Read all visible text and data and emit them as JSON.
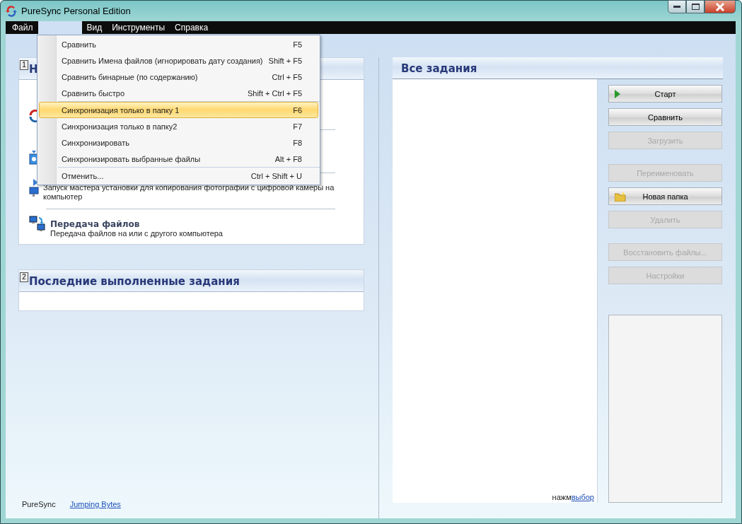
{
  "window": {
    "title": "PureSync Personal Edition"
  },
  "menu_bar": [
    {
      "label": "Файл",
      "selected": false
    },
    {
      "selected": true
    },
    {
      "label": "Вид",
      "selected": false
    },
    {
      "label": "Инструменты",
      "selected": false
    },
    {
      "label": "Справка",
      "selected": false
    }
  ],
  "dropdown": [
    {
      "kind": "item",
      "label": "Сравнить",
      "shortcut": "F5",
      "selected": false
    },
    {
      "kind": "item",
      "label": "Сравнить Имена файлов (игнорировать дату создания)",
      "shortcut": "Shift + F5",
      "selected": false
    },
    {
      "kind": "item",
      "label": "Сравнить бинарные (по содержанию)",
      "shortcut": "Ctrl + F5",
      "selected": false
    },
    {
      "kind": "item",
      "label": "Сравнить быстро",
      "shortcut": "Shift + Ctrl + F5",
      "selected": false
    },
    {
      "kind": "separator"
    },
    {
      "kind": "item",
      "label": "Синхронизация только в папку 1",
      "shortcut": "F6",
      "selected": true
    },
    {
      "kind": "item",
      "label": "Синхронизация только в папку2",
      "shortcut": "F7",
      "selected": false
    },
    {
      "kind": "item",
      "label": "Синхронизировать",
      "shortcut": "F8",
      "selected": false
    },
    {
      "kind": "item",
      "label": "Синхронизировать выбранные файлы",
      "shortcut": "Alt + F8",
      "selected": false
    },
    {
      "kind": "separator"
    },
    {
      "kind": "item",
      "label": "Отменить...",
      "shortcut": "Ctrl + Shift + U",
      "selected": false
    }
  ],
  "section_1": {
    "number": "1",
    "title": "Н",
    "tasks": [
      {
        "kind": "sync"
      },
      {
        "kind": "device"
      },
      {
        "kind": "camera",
        "description": "Запуск мастера установки для копирования фотографии с цифровой камеры на компьютер"
      },
      {
        "kind": "transfer",
        "title": "Передача файлов",
        "description": "Передача файлов на или с другого компьютера"
      }
    ]
  },
  "section_2": {
    "number": "2",
    "title": "Последние выполненные задания"
  },
  "footer": {
    "label": "PureSync",
    "link": "Jumping Bytes"
  },
  "all_tasks": {
    "title": "Все задания",
    "hint": "нажм",
    "hint_link": "выбор"
  },
  "buttons": [
    {
      "label": "Старт",
      "kind": "play",
      "disabled": false
    },
    {
      "label": "Сравнить",
      "kind": "plain",
      "disabled": false
    },
    {
      "label": "Загрузить",
      "kind": "plain",
      "disabled": true
    },
    {
      "label": "Переименовать",
      "kind": "plain",
      "disabled": true
    },
    {
      "label": "Новая папка",
      "kind": "folder",
      "disabled": false
    },
    {
      "label": "Удалить",
      "kind": "plain",
      "disabled": true
    },
    {
      "label": "Восстановить файлы...",
      "kind": "plain",
      "disabled": true
    },
    {
      "label": "Настройки",
      "kind": "plain",
      "disabled": true
    }
  ]
}
